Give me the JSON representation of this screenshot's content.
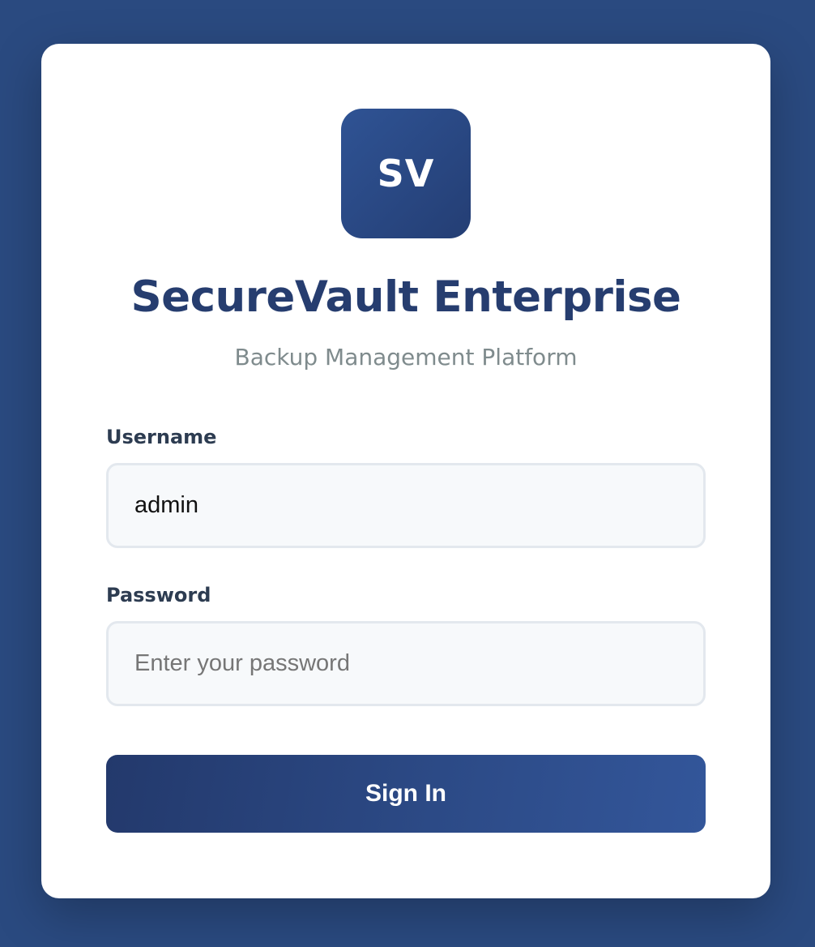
{
  "brand": {
    "logo_text": "SV",
    "title": "SecureVault Enterprise",
    "subtitle": "Backup Management Platform"
  },
  "form": {
    "username": {
      "label": "Username",
      "value": "admin",
      "placeholder": ""
    },
    "password": {
      "label": "Password",
      "value": "",
      "placeholder": "Enter your password"
    },
    "submit_label": "Sign In"
  },
  "colors": {
    "background": "#2a4a80",
    "brand_primary": "#263d6f",
    "button_gradient_start": "#23396c",
    "button_gradient_end": "#33569a",
    "subtitle": "#7f8b8d",
    "label": "#2d3c51"
  }
}
